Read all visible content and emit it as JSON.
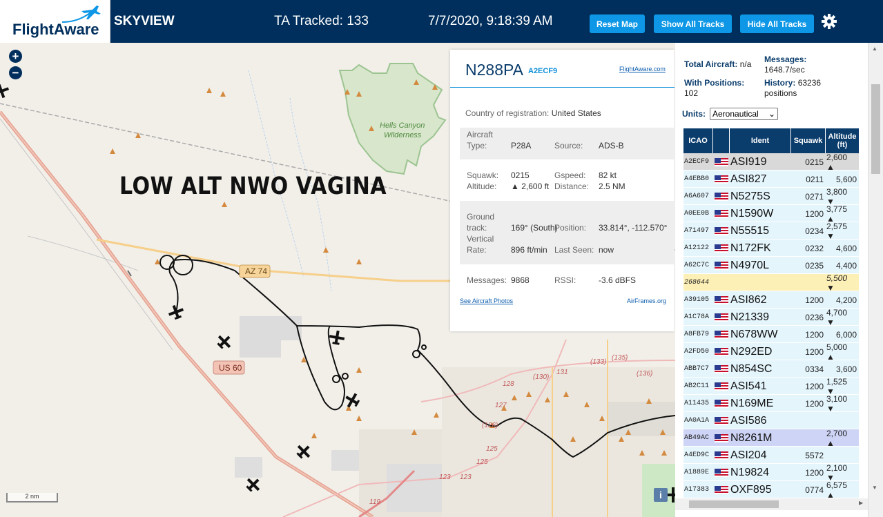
{
  "header": {
    "logo_text": "FlightAware",
    "app_name": "SKYVIEW",
    "tracked_label": "TA Tracked: 133",
    "datetime": "7/7/2020, 9:18:39 AM",
    "buttons": {
      "reset": "Reset Map",
      "show": "Show All Tracks",
      "hide": "Hide All Tracks"
    },
    "settings_icon": "gear-icon"
  },
  "map": {
    "zoom_in": "+",
    "zoom_out": "−",
    "overlay_text": "LOW ALT NWO VAGINA",
    "labels": {
      "wilderness": "Hells Canyon\nWilderness",
      "wilderness_line1": "Hells Canyon",
      "wilderness_line2": "Wilderness",
      "az74": "AZ 74",
      "us60": "US 60",
      "r128": "128",
      "r130": "(130)",
      "r131": "131",
      "r133": "(133)",
      "r135": "(135)",
      "r136": "(136)",
      "r126": "(126)",
      "r127": "127",
      "r125": "125",
      "r125b": "125",
      "r123": "123",
      "r123b": "123",
      "r119": "119"
    },
    "scale": "2 nm",
    "info_button": "i"
  },
  "popup": {
    "registration": "N288PA",
    "hex": "A2ECF9",
    "fa_link": "FlightAware.com",
    "country_label": "Country of registration:",
    "country": "United States",
    "aircraft_type_label1": "Aircraft",
    "aircraft_type_label2": "Type:",
    "aircraft_type": "P28A",
    "source_label": "Source:",
    "source": "ADS-B",
    "squawk_label": "Squawk:",
    "squawk": "0215",
    "gspeed_label": "Gspeed:",
    "gspeed": "82 kt",
    "altitude_label": "Altitude:",
    "altitude": "▲ 2,600 ft",
    "distance_label": "Distance:",
    "distance": "2.5 NM",
    "ground_label1": "Ground",
    "ground_label2": "track:",
    "ground_track": "169° (South)",
    "position_label": "Position:",
    "position": "33.814°, -112.570°",
    "vert_label1": "Vertical",
    "vert_label2": "Rate:",
    "vert_rate": "896 ft/min",
    "lastseen_label": "Last Seen:",
    "last_seen": "now",
    "messages_label": "Messages:",
    "messages": "9868",
    "rssi_label": "RSSI:",
    "rssi": "-3.6 dBFS",
    "photos_link": "See Aircraft Photos",
    "airframes_link": "AirFrames.org"
  },
  "stats": {
    "total_label": "Total Aircraft:",
    "total": "n/a",
    "messages_label": "Messages:",
    "messages": "1648.7/sec",
    "positions_label": "With Positions:",
    "positions": "102",
    "history_label": "History:",
    "history_count": "63236",
    "history_unit": "positions",
    "units_label": "Units:",
    "units_value": "Aeronautical"
  },
  "table": {
    "headers": {
      "icao": "ICAO",
      "ident": "Ident",
      "squawk": "Squawk",
      "alt1": "Altitude",
      "alt2": "(ft)"
    },
    "rows": [
      {
        "icao": "A2ECF9",
        "flag": true,
        "ident": "ASI919",
        "squawk": "0215",
        "alt": "2,600 ▲",
        "hl": "sel"
      },
      {
        "icao": "A4EBB0",
        "flag": true,
        "ident": "ASI827",
        "squawk": "0211",
        "alt": "5,600",
        "hl": ""
      },
      {
        "icao": "A6A607",
        "flag": true,
        "ident": "N5275S",
        "squawk": "0271",
        "alt": "3,800 ▼",
        "hl": ""
      },
      {
        "icao": "A0EE0B",
        "flag": true,
        "ident": "N1590W",
        "squawk": "1200",
        "alt": "3,775 ▲",
        "hl": ""
      },
      {
        "icao": "A71497",
        "flag": true,
        "ident": "N55515",
        "squawk": "0234",
        "alt": "2,575 ▼",
        "hl": ""
      },
      {
        "icao": "A12122",
        "flag": true,
        "ident": "N172FK",
        "squawk": "0232",
        "alt": "4,600",
        "hl": ""
      },
      {
        "icao": "A62C7C",
        "flag": true,
        "ident": "N4970L",
        "squawk": "0235",
        "alt": "4,400",
        "hl": ""
      },
      {
        "icao": "268644",
        "flag": false,
        "ident": "",
        "squawk": "",
        "alt": "5,500 ▼",
        "hl": "tisb"
      },
      {
        "icao": "A39105",
        "flag": true,
        "ident": "ASI862",
        "squawk": "1200",
        "alt": "4,200",
        "hl": ""
      },
      {
        "icao": "A1C78A",
        "flag": true,
        "ident": "N21339",
        "squawk": "0236",
        "alt": "4,700 ▼",
        "hl": ""
      },
      {
        "icao": "A8FB79",
        "flag": true,
        "ident": "N678WW",
        "squawk": "1200",
        "alt": "6,000",
        "hl": ""
      },
      {
        "icao": "A2FD50",
        "flag": true,
        "ident": "N292ED",
        "squawk": "1200",
        "alt": "5,000 ▲",
        "hl": ""
      },
      {
        "icao": "ABB7C7",
        "flag": true,
        "ident": "N854SC",
        "squawk": "0334",
        "alt": "3,600",
        "hl": ""
      },
      {
        "icao": "AB2C11",
        "flag": true,
        "ident": "ASI541",
        "squawk": "1200",
        "alt": "1,525 ▼",
        "hl": ""
      },
      {
        "icao": "A11435",
        "flag": true,
        "ident": "N169ME",
        "squawk": "1200",
        "alt": "3,100 ▼",
        "hl": ""
      },
      {
        "icao": "AA0A1A",
        "flag": true,
        "ident": "ASI586",
        "squawk": "",
        "alt": "",
        "hl": ""
      },
      {
        "icao": "AB49AC",
        "flag": true,
        "ident": "N8261M",
        "squawk": "",
        "alt": "2,700 ▲",
        "hl": "mlat"
      },
      {
        "icao": "A4ED9C",
        "flag": true,
        "ident": "ASI204",
        "squawk": "5572",
        "alt": "",
        "hl": ""
      },
      {
        "icao": "A1889E",
        "flag": true,
        "ident": "N19824",
        "squawk": "1200",
        "alt": "2,100 ▼",
        "hl": ""
      },
      {
        "icao": "A17383",
        "flag": true,
        "ident": "OXF895",
        "squawk": "0774",
        "alt": "6,575 ▲",
        "hl": ""
      }
    ]
  },
  "colors": {
    "brand": "#002f5d",
    "button": "#0d97e6",
    "row": "#e4f5fc",
    "selected": "#d9d9d9",
    "tisb": "#fdf0b6",
    "mlat": "#cdd4f5",
    "track": "#111111"
  }
}
